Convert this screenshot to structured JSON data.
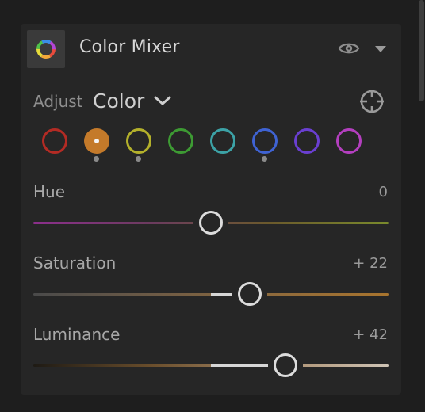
{
  "panel": {
    "title": "Color Mixer",
    "icon": "color-wheel-icon"
  },
  "header_controls": {
    "visibility_icon": "eye-icon",
    "collapse_icon": "triangle-down-icon"
  },
  "adjust": {
    "label": "Adjust",
    "value": "Color",
    "dropdown_icon": "chevron-down-icon",
    "target_icon": "crosshair-target-icon"
  },
  "swatches": [
    {
      "name": "red",
      "color": "#b32b24",
      "selected": false,
      "has_adjustment": false
    },
    {
      "name": "orange",
      "color": "#c47a2a",
      "selected": true,
      "has_adjustment": true
    },
    {
      "name": "yellow",
      "color": "#b3b02b",
      "selected": false,
      "has_adjustment": true
    },
    {
      "name": "green",
      "color": "#3d9a33",
      "selected": false,
      "has_adjustment": false
    },
    {
      "name": "aqua",
      "color": "#3ca2a6",
      "selected": false,
      "has_adjustment": false
    },
    {
      "name": "blue",
      "color": "#3f63d3",
      "selected": false,
      "has_adjustment": true
    },
    {
      "name": "purple",
      "color": "#6a3fd1",
      "selected": false,
      "has_adjustment": false
    },
    {
      "name": "magenta",
      "color": "#b43fbf",
      "selected": false,
      "has_adjustment": false
    }
  ],
  "sliders": [
    {
      "name": "hue",
      "label": "Hue",
      "value_text": "0",
      "value": 0,
      "min": -100,
      "max": 100,
      "track_colors": [
        "#8c2f8c",
        "#6b3b5e",
        "#6b5a2c",
        "#7a8a2c"
      ]
    },
    {
      "name": "saturation",
      "label": "Saturation",
      "value_text": "+ 22",
      "value": 22,
      "min": -100,
      "max": 100,
      "track_colors": [
        "#4a4a4a",
        "#6c5a46",
        "#8e6a3c",
        "#a8742e"
      ]
    },
    {
      "name": "luminance",
      "label": "Luminance",
      "value_text": "+ 42",
      "value": 42,
      "min": -100,
      "max": 100,
      "track_colors": [
        "#1e1a14",
        "#6a4e2c",
        "#a88a68",
        "#cfc4b6"
      ]
    }
  ]
}
